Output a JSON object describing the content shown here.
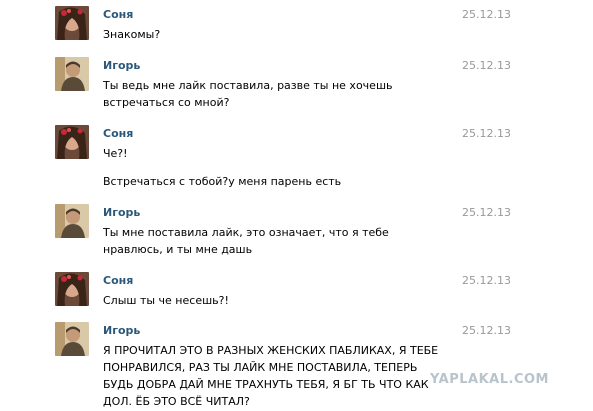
{
  "conversation": {
    "messages": [
      {
        "author": "Соня",
        "date": "25.12.13",
        "avatar": "sonya-avatar",
        "lines": [
          "Знакомы?"
        ]
      },
      {
        "author": "Игорь",
        "date": "25.12.13",
        "avatar": "igor-avatar",
        "lines": [
          "Ты ведь мне лайк поставила, разве ты не хочешь встречаться со мной?"
        ]
      },
      {
        "author": "Соня",
        "date": "25.12.13",
        "avatar": "sonya-avatar",
        "lines": [
          "Че?!",
          "Встречаться с тобой?у меня парень есть"
        ]
      },
      {
        "author": "Игорь",
        "date": "25.12.13",
        "avatar": "igor-avatar",
        "lines": [
          "Ты мне поставила лайк, это означает, что я тебе нравлюсь, и ты мне дашь"
        ]
      },
      {
        "author": "Соня",
        "date": "25.12.13",
        "avatar": "sonya-avatar",
        "lines": [
          "Слыш ты че несешь?!"
        ]
      },
      {
        "author": "Игорь",
        "date": "25.12.13",
        "avatar": "igor-avatar",
        "lines": [
          "Я ПРОЧИТАЛ ЭТО В РАЗНЫХ ЖЕНСКИХ ПАБЛИКАХ, Я ТЕБЕ ПОНРАВИЛСЯ, РАЗ ТЫ ЛАЙК МНЕ ПОСТАВИЛА, ТЕПЕРЬ БУДЬ ДОБРА ДАЙ МНЕ ТРАХНУТЬ ТЕБЯ, Я БГ  ТЬ ЧТО КАК ДОЛ. ЁБ ЭТО ВСЁ ЧИТАЛ?"
        ]
      }
    ]
  },
  "watermark": "YAPLAKAL.COM",
  "colors": {
    "author": "#2b587a",
    "date": "#999999",
    "text": "#000000",
    "background": "#ffffff"
  }
}
